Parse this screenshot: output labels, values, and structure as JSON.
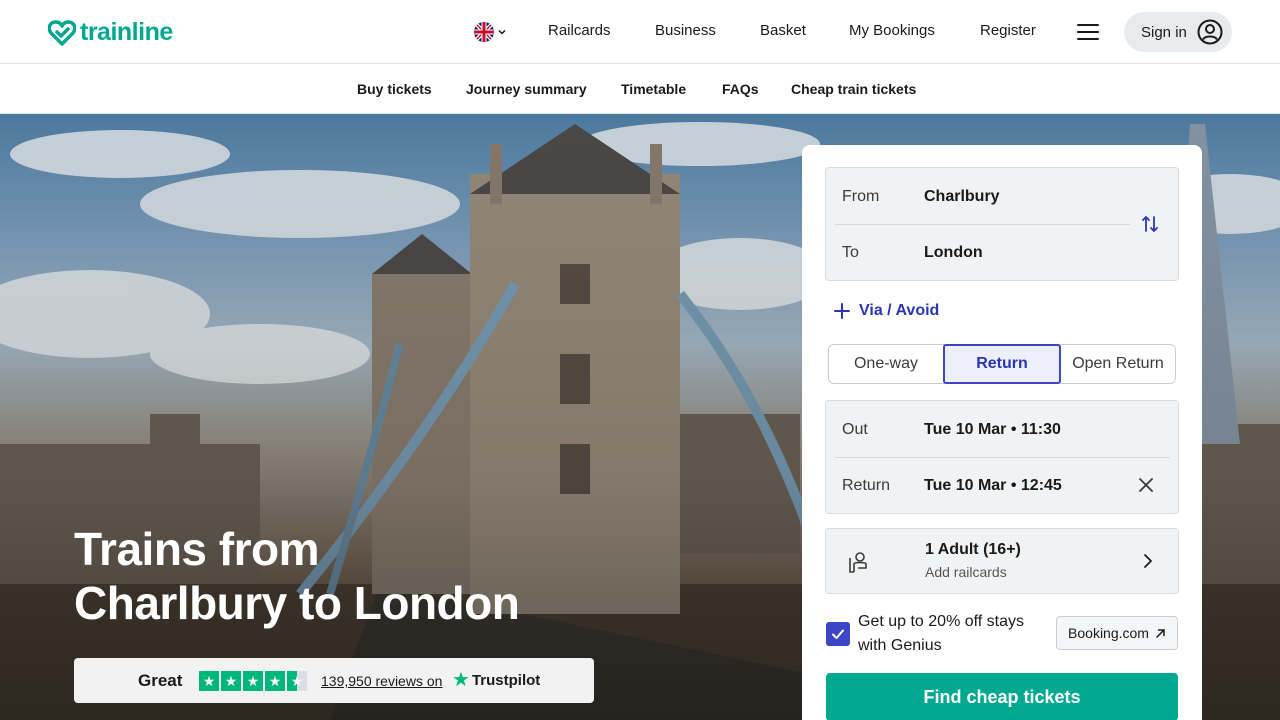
{
  "brand": {
    "name": "trainline",
    "color": "#00a88f"
  },
  "header": {
    "nav": [
      "Railcards",
      "Business",
      "Basket",
      "My Bookings",
      "Register"
    ],
    "signin_label": "Sign in"
  },
  "subnav": [
    "Buy tickets",
    "Journey summary",
    "Timetable",
    "FAQs",
    "Cheap train tickets"
  ],
  "hero": {
    "title_line1": "Trains from",
    "title_line2": "Charlbury to London"
  },
  "trustpilot": {
    "rating_text": "Great",
    "stars": 4.5,
    "reviews": "139,950 reviews on",
    "brand": "Trustpilot"
  },
  "search": {
    "from_label": "From",
    "from_value": "Charlbury",
    "to_label": "To",
    "to_value": "London",
    "via_label": "Via / Avoid",
    "trip_types": [
      "One-way",
      "Return",
      "Open Return"
    ],
    "selected_trip": "Return",
    "out_label": "Out",
    "out_value": "Tue 10 Mar • 11:30",
    "return_label": "Return",
    "return_value": "Tue 10 Mar • 12:45",
    "passengers": "1 Adult (16+)",
    "railcards": "Add railcards",
    "genius_text": "Get up to 20% off stays with Genius",
    "genius_checked": true,
    "booking_label": "Booking.com",
    "cta": "Find cheap tickets"
  },
  "colors": {
    "accent_blue": "#3d46c4",
    "cta_green": "#00a88f",
    "trustpilot_green": "#00b67a"
  },
  "icons": [
    "heart-logo-icon",
    "uk-flag-icon",
    "chevron-down-icon",
    "hamburger-icon",
    "user-circle-icon",
    "swap-icon",
    "plus-icon",
    "close-icon",
    "passenger-icon",
    "chevron-right-icon",
    "checkmark-icon",
    "external-link-icon",
    "trustpilot-star-icon"
  ]
}
